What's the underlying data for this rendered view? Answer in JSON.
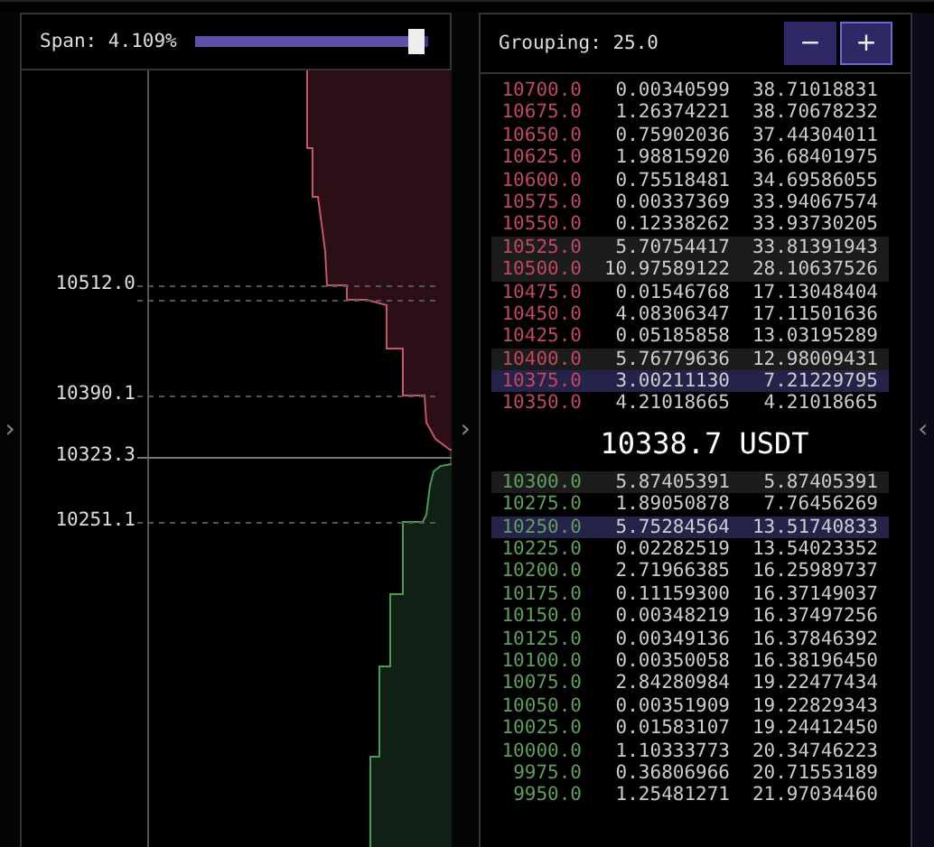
{
  "side_arrows": [
    "›",
    "›",
    "‹"
  ],
  "span": {
    "label": "Span: 4.109%",
    "level": 0.95
  },
  "depth_chart": {
    "axis_labels": [
      {
        "text": "10512.0",
        "kind": "mark"
      },
      {
        "text": "10390.1",
        "kind": "mark"
      },
      {
        "text": "10323.3",
        "kind": "current"
      },
      {
        "text": "10251.1",
        "kind": "mark"
      }
    ]
  },
  "grouping": {
    "label": "Grouping: 25.0",
    "buttons": [
      {
        "text": "−",
        "selected": false
      },
      {
        "text": "+",
        "selected": true
      }
    ]
  },
  "asks": [
    {
      "price": "10700.0",
      "size": "0.00340599",
      "total": "38.71018831",
      "large": false,
      "selected": false
    },
    {
      "price": "10675.0",
      "size": "1.26374221",
      "total": "38.70678232",
      "large": false,
      "selected": false
    },
    {
      "price": "10650.0",
      "size": "0.75902036",
      "total": "37.44304011",
      "large": false,
      "selected": false
    },
    {
      "price": "10625.0",
      "size": "1.98815920",
      "total": "36.68401975",
      "large": false,
      "selected": false
    },
    {
      "price": "10600.0",
      "size": "0.75518481",
      "total": "34.69586055",
      "large": false,
      "selected": false
    },
    {
      "price": "10575.0",
      "size": "0.00337369",
      "total": "33.94067574",
      "large": false,
      "selected": false
    },
    {
      "price": "10550.0",
      "size": "0.12338262",
      "total": "33.93730205",
      "large": false,
      "selected": false
    },
    {
      "price": "10525.0",
      "size": "5.70754417",
      "total": "33.81391943",
      "large": true,
      "selected": false
    },
    {
      "price": "10500.0",
      "size": "10.97589122",
      "total": "28.10637526",
      "large": true,
      "selected": false
    },
    {
      "price": "10475.0",
      "size": "0.01546768",
      "total": "17.13048404",
      "large": false,
      "selected": false
    },
    {
      "price": "10450.0",
      "size": "4.08306347",
      "total": "17.11501636",
      "large": false,
      "selected": false
    },
    {
      "price": "10425.0",
      "size": "0.05185858",
      "total": "13.03195289",
      "large": false,
      "selected": false
    },
    {
      "price": "10400.0",
      "size": "5.76779636",
      "total": "12.98009431",
      "large": true,
      "selected": false
    },
    {
      "price": "10375.0",
      "size": "3.00211130",
      "total": "7.21229795",
      "large": false,
      "selected": true
    },
    {
      "price": "10350.0",
      "size": "4.21018665",
      "total": "4.21018665",
      "large": false,
      "selected": false
    }
  ],
  "mid_price": "10338.7 USDT",
  "bids": [
    {
      "price": "10300.0",
      "size": "5.87405391",
      "total": "5.87405391",
      "large": true,
      "selected": false
    },
    {
      "price": "10275.0",
      "size": "1.89050878",
      "total": "7.76456269",
      "large": false,
      "selected": false
    },
    {
      "price": "10250.0",
      "size": "5.75284564",
      "total": "13.51740833",
      "large": false,
      "selected": true
    },
    {
      "price": "10225.0",
      "size": "0.02282519",
      "total": "13.54023352",
      "large": false,
      "selected": false
    },
    {
      "price": "10200.0",
      "size": "2.71966385",
      "total": "16.25989737",
      "large": false,
      "selected": false
    },
    {
      "price": "10175.0",
      "size": "0.11159300",
      "total": "16.37149037",
      "large": false,
      "selected": false
    },
    {
      "price": "10150.0",
      "size": "0.00348219",
      "total": "16.37497256",
      "large": false,
      "selected": false
    },
    {
      "price": "10125.0",
      "size": "0.00349136",
      "total": "16.37846392",
      "large": false,
      "selected": false
    },
    {
      "price": "10100.0",
      "size": "0.00350058",
      "total": "16.38196450",
      "large": false,
      "selected": false
    },
    {
      "price": "10075.0",
      "size": "2.84280984",
      "total": "19.22477434",
      "large": false,
      "selected": false
    },
    {
      "price": "10050.0",
      "size": "0.00351909",
      "total": "19.22829343",
      "large": false,
      "selected": false
    },
    {
      "price": "10025.0",
      "size": "0.01583107",
      "total": "19.24412450",
      "large": false,
      "selected": false
    },
    {
      "price": "10000.0",
      "size": "1.10333773",
      "total": "20.34746223",
      "large": false,
      "selected": false
    },
    {
      "price": "9975.0",
      "size": "0.36806966",
      "total": "20.71553189",
      "large": false,
      "selected": false
    },
    {
      "price": "9950.0",
      "size": "1.25481271",
      "total": "21.97034460",
      "large": false,
      "selected": false
    }
  ]
}
